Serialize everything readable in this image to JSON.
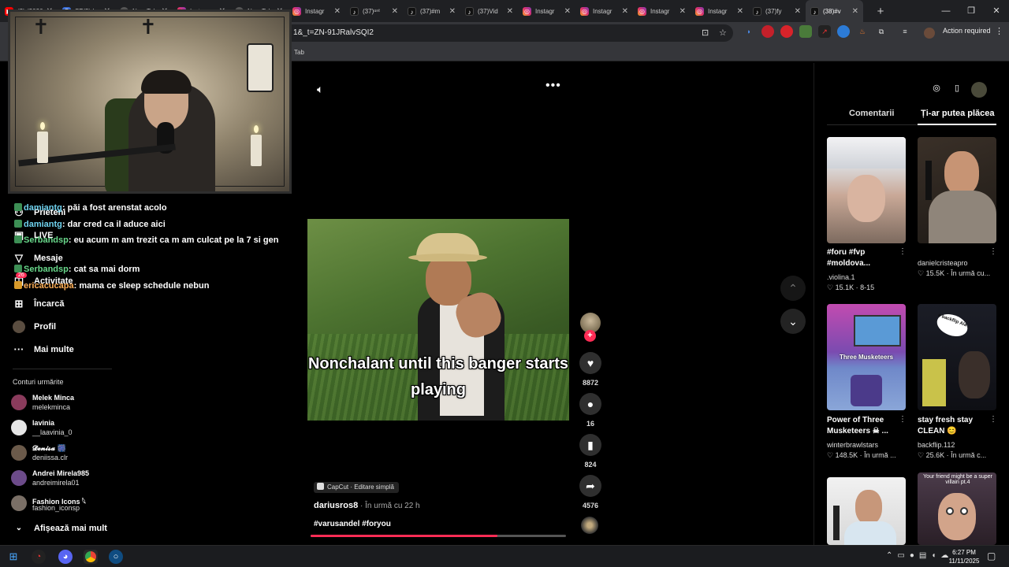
{
  "browser": {
    "tabs": [
      {
        "title": "(2) (2026",
        "favicon": "youtube"
      },
      {
        "title": "ST(2)day",
        "favicon": "generic"
      },
      {
        "title": "New Tab",
        "favicon": "globe"
      },
      {
        "title": "Instagr",
        "favicon": "instagram"
      },
      {
        "title": "New Tab",
        "favicon": "globe"
      },
      {
        "title": "Instagr",
        "favicon": "instagram"
      },
      {
        "title": "(37)ᵘⁿᵗ",
        "favicon": "tiktok"
      },
      {
        "title": "(37)#m",
        "favicon": "tiktok"
      },
      {
        "title": "(37)Vid",
        "favicon": "tiktok"
      },
      {
        "title": "Instagr",
        "favicon": "instagram"
      },
      {
        "title": "Instagr",
        "favicon": "instagram"
      },
      {
        "title": "Instagr",
        "favicon": "instagram"
      },
      {
        "title": "Instagr",
        "favicon": "instagram"
      },
      {
        "title": "(37)fy",
        "favicon": "tiktok"
      },
      {
        "title": "(38)#v",
        "favicon": "tiktok",
        "active": true
      }
    ],
    "new_tab_label": "+",
    "url": "1&_t=ZN-91JRalvSQI2",
    "action_required": "Action required",
    "bookmark_label": "Tab"
  },
  "webcam_chat": [
    {
      "user": "damiantg",
      "message": "păi a fost arenstat acolo",
      "color": "cyan"
    },
    {
      "user": "damiantg",
      "message": "dar cred ca il aduce aici",
      "color": "cyan"
    },
    {
      "user": "Serbandsp",
      "message": "eu acum m am trezit ca m am culcat pe la 7 si gen",
      "color": "green"
    },
    {
      "user": "Serbandsp",
      "message": "cat sa mai dorm",
      "color": "green"
    },
    {
      "user": "ericacucapa",
      "message": "mama ce sleep schedule nebun",
      "color": "orange"
    }
  ],
  "nav": {
    "items": [
      {
        "label": "Prieteni",
        "icon": "friends-icon"
      },
      {
        "label": "LIVE",
        "icon": "live-icon"
      },
      {
        "label": "Mesaje",
        "icon": "messages-icon"
      },
      {
        "label": "Activitate",
        "icon": "activity-icon",
        "badge": "26"
      },
      {
        "label": "Încarcă",
        "icon": "upload-icon"
      },
      {
        "label": "Profil",
        "icon": "profile-icon"
      },
      {
        "label": "Mai multe",
        "icon": "more-icon"
      }
    ],
    "following_title": "Conturi urmărite",
    "following": [
      {
        "name": "Melek Minca",
        "handle": "melekminca",
        "color": "#8a3b5c"
      },
      {
        "name": "lavinia",
        "handle": "__laavinia_0",
        "color": "#e6e6e6"
      },
      {
        "name": "𝓓𝓮𝓷𝓲𝓼𝓪 🎆",
        "handle": "deniissa.clr",
        "color": "#6b5a4a"
      },
      {
        "name": "Andrei Mirela985",
        "handle": "andreimirela01",
        "color": "#6c4b8a"
      },
      {
        "name": "Fashion Icons 𓆩",
        "handle": "fashion_iconsp",
        "color": "#7a6f66"
      }
    ],
    "show_more": "Afișează mai mult"
  },
  "video": {
    "caption": "Nonchalant until this banger starts playing",
    "likes": "8872",
    "comments": "16",
    "saves": "824",
    "shares": "4576",
    "capcut_label": "CapCut · Editare simplă",
    "author": "dariusros8",
    "time": " · În urmă cu 22 h",
    "hashtags": "#varusandel #foryou",
    "progress_fraction": 0.73
  },
  "right_panel": {
    "tabs": [
      "Comentarii",
      "Ți-ar putea plăcea"
    ],
    "cards": [
      {
        "title": "#foru #fvp #moldova...",
        "author": ".violina.1",
        "stats": "♡ 15.1K · 8-15",
        "thumb": "snow"
      },
      {
        "title": "",
        "author": "danielcristeapro",
        "stats": "♡ 15.5K · În urmă cu...",
        "thumb": "man"
      },
      {
        "title": "Power of Three Musketeers ☠ ...",
        "author": "winterbrawlstars",
        "stats": "♡ 148.5K · În urmă ...",
        "thumb": "game",
        "thumb_text": "Three Musketeers"
      },
      {
        "title": "stay fresh stay CLEAN 😊",
        "author": "backflip.112",
        "stats": "♡ 25.6K · În urmă c...",
        "thumb": "night",
        "thumb_text": "e backflip Ala"
      },
      {
        "title": "",
        "author": "",
        "stats": "",
        "thumb": "podcast"
      },
      {
        "title": "",
        "author": "",
        "stats": "",
        "thumb": "face",
        "thumb_text": "Your friend might be a super villain pt.4"
      }
    ]
  },
  "taskbar": {
    "time": "6:27 PM",
    "date": "11/11/2025"
  }
}
